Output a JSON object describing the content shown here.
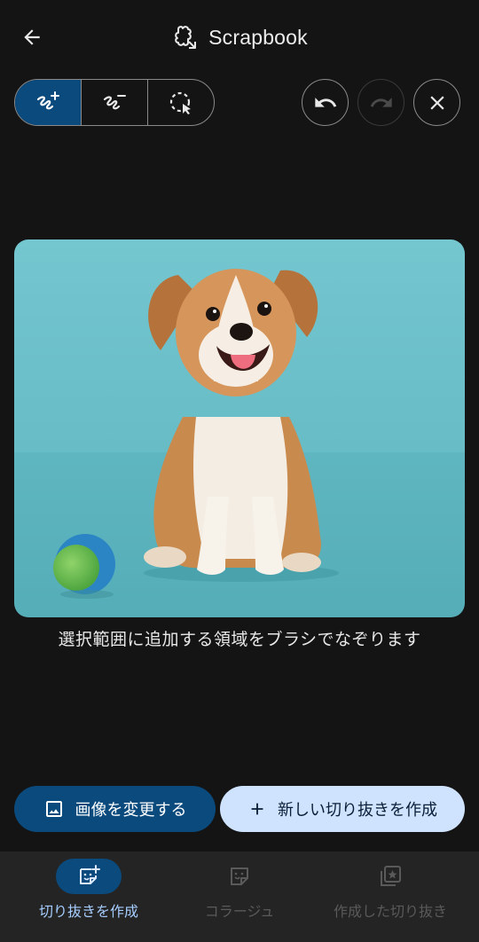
{
  "header": {
    "title": "Scrapbook",
    "back_icon": "arrow-left-icon",
    "app_icon": "puzzle-sticker-icon"
  },
  "toolbar": {
    "segments": [
      {
        "name": "brush-add",
        "icon": "brush-add-icon",
        "active": true
      },
      {
        "name": "brush-remove",
        "icon": "brush-remove-icon",
        "active": false
      },
      {
        "name": "lasso",
        "icon": "lasso-select-icon",
        "active": false
      }
    ],
    "undo_icon": "undo-icon",
    "redo_icon": "redo-icon",
    "redo_enabled": false,
    "close_icon": "close-icon"
  },
  "canvas": {
    "image_subject": "dog-photo",
    "hint": "選択範囲に追加する領域をブラシでなぞります"
  },
  "actions": {
    "change_image_label": "画像を変更する",
    "new_cutout_label": "新しい切り抜きを作成"
  },
  "nav": {
    "items": [
      {
        "label": "切り抜きを作成",
        "icon": "sticker-add-icon",
        "active": true
      },
      {
        "label": "コラージュ",
        "icon": "sticker-icon",
        "active": false
      },
      {
        "label": "作成した切り抜き",
        "icon": "sticker-library-icon",
        "active": false
      }
    ]
  },
  "colors": {
    "background": "#141414",
    "accent": "#0b4a7d",
    "accent_light": "#cfe3ff",
    "nav_bg": "#242424",
    "photo_bg": "#6ec2cc"
  }
}
